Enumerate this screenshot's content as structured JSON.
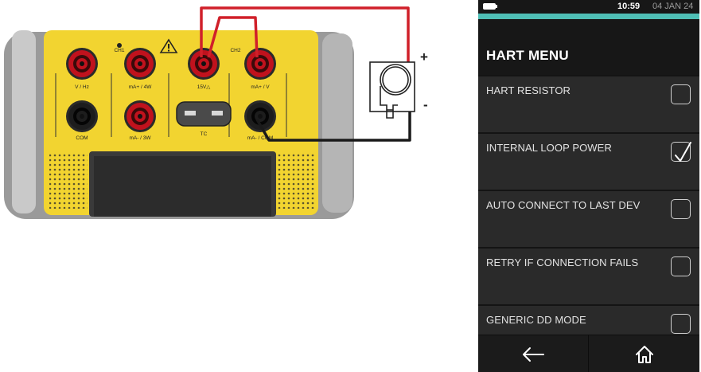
{
  "diagram": {
    "meter_labels": {
      "v_hz": "V / Hz",
      "ma_4w": "mA+ / 4W",
      "v24": "15V△",
      "ma_v": "mA+ / V",
      "com_left": "COM",
      "ma_3w": "mA- / 3W",
      "tc": "TC",
      "ma_com": "mA- / COM",
      "ch1": "CH1",
      "ch2": "CH2"
    },
    "polarity": {
      "plus": "+",
      "minus": "-"
    },
    "colors": {
      "wire": "#d0202a",
      "meter_yellow": "#f2d430",
      "meter_grey": "#8e8e8e"
    }
  },
  "device": {
    "status": {
      "time": "10:59",
      "date": "04 JAN 24"
    },
    "title": "HART MENU",
    "items": [
      {
        "label": "HART RESISTOR",
        "checked": false
      },
      {
        "label": "INTERNAL LOOP POWER",
        "checked": true
      },
      {
        "label": "AUTO CONNECT TO LAST DEV",
        "checked": false
      },
      {
        "label": "RETRY IF CONNECTION FAILS",
        "checked": false
      },
      {
        "label": "GENERIC DD MODE",
        "checked": false
      }
    ],
    "nav": {
      "back_icon": "back-arrow-icon",
      "home_icon": "home-icon"
    },
    "colors": {
      "accent": "#4fbfb6",
      "background": "#2a2a2a",
      "bar": "#171717"
    }
  }
}
